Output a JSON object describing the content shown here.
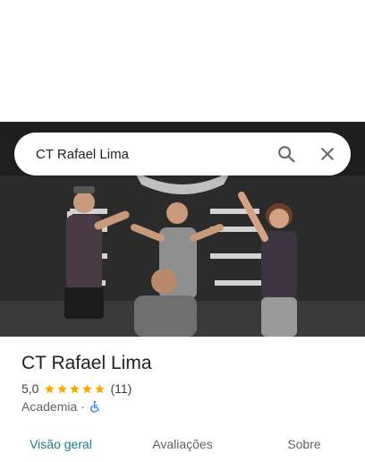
{
  "search": {
    "query": "CT Rafael Lima"
  },
  "icons": {
    "search": "search-icon",
    "close": "close-icon",
    "star": "star-icon",
    "accessibility": "wheelchair-icon"
  },
  "hero": {
    "wall_text": [
      "CENTRO",
      "TREINAMENTO",
      "RAFAEL LIMA"
    ]
  },
  "place": {
    "name": "CT Rafael Lima",
    "rating": "5,0",
    "stars": 5,
    "reviews_count": "(11)",
    "category": "Academia",
    "separator": "·"
  },
  "tabs": [
    {
      "label": "Visão geral",
      "active": true
    },
    {
      "label": "Avaliações",
      "active": false
    },
    {
      "label": "Sobre",
      "active": false
    }
  ],
  "colors": {
    "star": "#f9ab00",
    "active_tab": "#1a7a87",
    "accessibility": "#1a73e8"
  }
}
